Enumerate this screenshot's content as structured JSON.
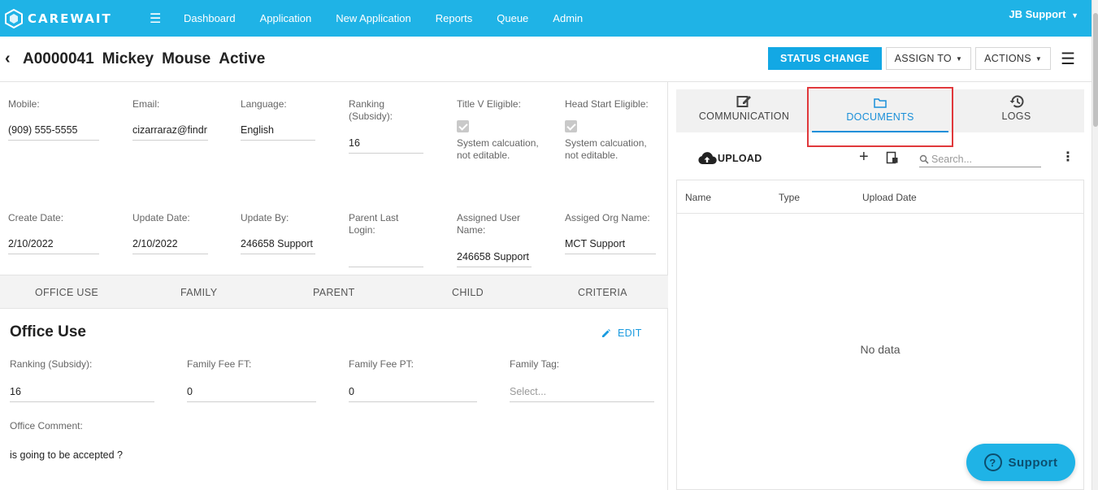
{
  "brand": {
    "name": "CAREWAIT"
  },
  "nav": {
    "items": [
      "Dashboard",
      "Application",
      "New Application",
      "Reports",
      "Queue",
      "Admin"
    ],
    "user": "JB Support"
  },
  "header": {
    "id": "A0000041",
    "first_name": "Mickey",
    "last_name": "Mouse",
    "status": "Active",
    "status_change": "STATUS CHANGE",
    "assign_to": "ASSIGN TO",
    "actions": "ACTIONS"
  },
  "details": {
    "mobile": {
      "label": "Mobile:",
      "value": "(909) 555-5555"
    },
    "email": {
      "label": "Email:",
      "value": "cizarraraz@findr"
    },
    "language": {
      "label": "Language:",
      "value": "English"
    },
    "ranking": {
      "label": "Ranking (Subsidy):",
      "value": "16"
    },
    "title_v": {
      "label": "Title V Eligible:",
      "note": "System calcuation, not editable."
    },
    "head_start": {
      "label": "Head Start Eligible:",
      "note": "System calcuation, not editable."
    },
    "create_date": {
      "label": "Create Date:",
      "value": "2/10/2022"
    },
    "update_date": {
      "label": "Update Date:",
      "value": "2/10/2022"
    },
    "update_by": {
      "label": "Update By:",
      "value": "246658 Support"
    },
    "parent_last_login": {
      "label": "Parent Last Login:",
      "value": ""
    },
    "assigned_user": {
      "label": "Assigned User Name:",
      "value": "246658 Support"
    },
    "assigned_org": {
      "label": "Assiged Org Name:",
      "value": "MCT Support"
    }
  },
  "subtabs": [
    "OFFICE USE",
    "FAMILY",
    "PARENT",
    "CHILD",
    "CRITERIA"
  ],
  "office_use": {
    "title": "Office Use",
    "edit": "EDIT",
    "ranking": {
      "label": "Ranking (Subsidy):",
      "value": "16"
    },
    "fee_ft": {
      "label": "Family Fee FT:",
      "value": "0"
    },
    "fee_pt": {
      "label": "Family Fee PT:",
      "value": "0"
    },
    "tag": {
      "label": "Family Tag:",
      "placeholder": "Select..."
    },
    "comment": {
      "label": "Office Comment:",
      "value": "is going to be accepted ?"
    }
  },
  "right_tabs": {
    "communication": "COMMUNICATION",
    "documents": "DOCUMENTS",
    "logs": "LOGS"
  },
  "documents": {
    "upload": "UPLOAD",
    "search_placeholder": "Search...",
    "columns": [
      "Name",
      "Type",
      "Upload Date"
    ],
    "empty": "No data"
  },
  "support": {
    "label": "Support"
  },
  "colors": {
    "brand": "#1fb3e6",
    "primary_button": "#13a8e4",
    "active_tab": "#1a8fd9",
    "highlight": "#e0383b"
  }
}
